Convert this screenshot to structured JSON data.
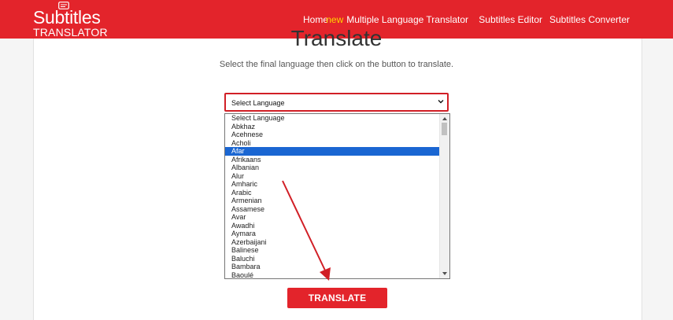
{
  "logo": {
    "main": "Subtitles",
    "sub": "TRANSLATOR",
    "icon": "subtitles-icon"
  },
  "nav": {
    "home": "Home",
    "new_badge": "new",
    "multi": "Multiple Language Translator",
    "editor": "Subtitles Editor",
    "converter": "Subtitles Converter"
  },
  "main": {
    "title": "Translate",
    "subtitle": "Select the final language then click on the button to translate."
  },
  "select": {
    "value": "Select Language",
    "options": [
      "Select Language",
      "Abkhaz",
      "Acehnese",
      "Acholi",
      "Afar",
      "Afrikaans",
      "Albanian",
      "Alur",
      "Amharic",
      "Arabic",
      "Armenian",
      "Assamese",
      "Avar",
      "Awadhi",
      "Aymara",
      "Azerbaijani",
      "Balinese",
      "Baluchi",
      "Bambara",
      "Baoulé"
    ],
    "highlighted": "Afar"
  },
  "button": {
    "label": "TRANSLATE"
  },
  "colors": {
    "brand": "#e3242b",
    "highlight": "#1a66d2",
    "new_badge": "#ffd400"
  }
}
